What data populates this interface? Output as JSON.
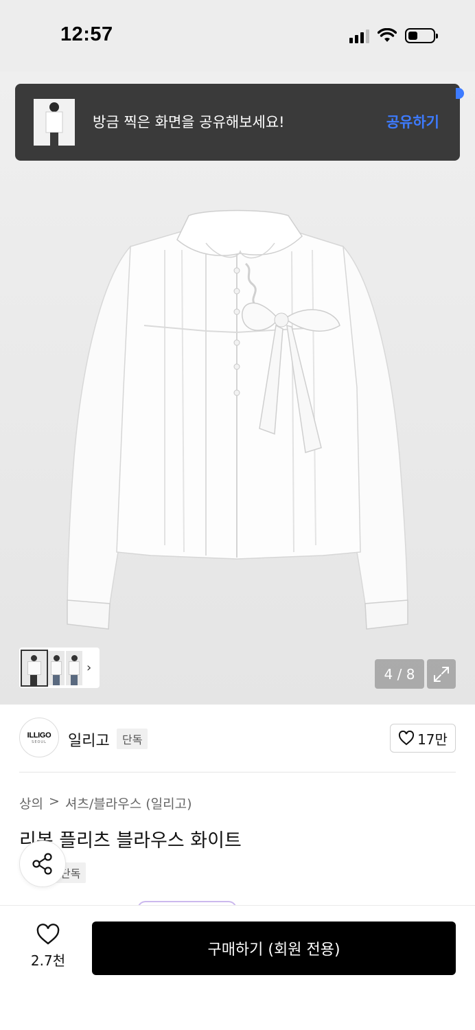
{
  "status_bar": {
    "time": "12:57",
    "battery_level": 0.3
  },
  "toast": {
    "message": "방금 찍은 화면을 공유해보세요!",
    "action_label": "공유하기",
    "accent_color": "#3d7bff"
  },
  "gallery": {
    "counter": "4 / 8",
    "thumbnail_chevron": "›"
  },
  "brand": {
    "logo_text": "ILLIGO",
    "logo_subtext": "SEOUL",
    "name": "일리고",
    "tag": "단독",
    "likes": "17만"
  },
  "breadcrumb": {
    "category": "상의",
    "separator": ">",
    "subcategory": "셔츠/블라우스 (일리고)"
  },
  "product": {
    "name": "리본 플리츠 블라우스 화이트",
    "tag": "단독"
  },
  "bottom_bar": {
    "wish_count": "2.7천",
    "buy_label": "구매하기 (회원 전용)"
  },
  "icons": [
    "signal-icon",
    "wifi-icon",
    "battery-icon",
    "expand-icon",
    "heart-icon",
    "share-icon",
    "chevron-right-icon"
  ]
}
